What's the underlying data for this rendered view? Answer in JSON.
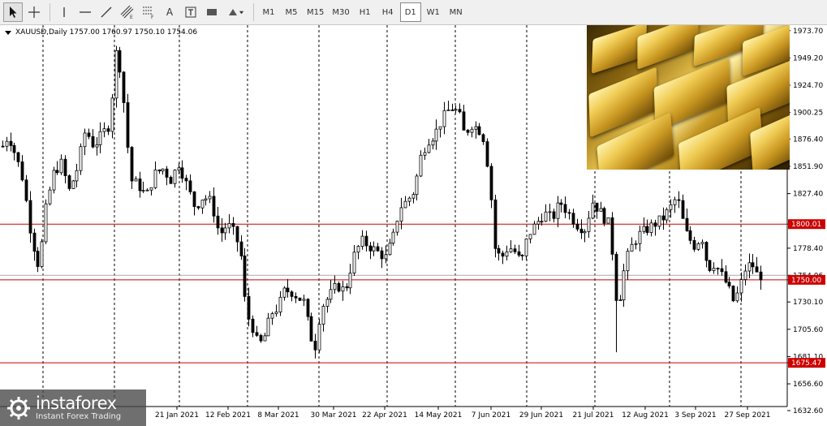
{
  "toolbar": {
    "tools": [
      {
        "name": "cursor-tool",
        "icon": "arrow-cursor-icon"
      },
      {
        "name": "crosshair-tool",
        "icon": "crosshair-icon"
      },
      {
        "name": "vertical-line-tool",
        "icon": "vertical-line-icon"
      },
      {
        "name": "horizontal-line-tool",
        "icon": "horizontal-line-icon"
      },
      {
        "name": "trendline-tool",
        "icon": "trendline-icon"
      },
      {
        "name": "equidistant-channel-tool",
        "icon": "channel-icon"
      },
      {
        "name": "fibonacci-tool",
        "icon": "fibonacci-icon"
      },
      {
        "name": "text-tool",
        "label": "A"
      },
      {
        "name": "text-label-tool",
        "icon": "text-label-icon"
      },
      {
        "name": "rectangle-tool",
        "icon": "rectangle-icon"
      },
      {
        "name": "shapes-dropdown",
        "icon": "shapes-icon"
      }
    ],
    "timeframes": [
      "M1",
      "M5",
      "M15",
      "M30",
      "H1",
      "H4",
      "D1",
      "W1",
      "MN"
    ],
    "active_timeframe": "D1"
  },
  "chart": {
    "symbol_line": "XAUUSD,Daily  1757.00 1760.97 1750.10 1754.06",
    "y_ticks": [
      "1973.70",
      "1949.20",
      "1924.70",
      "1900.25",
      "1876.40",
      "1851.90",
      "1827.40",
      "1800.01",
      "1778.40",
      "1754.06",
      "1750.00",
      "1730.10",
      "1705.60",
      "1681.10",
      "1675.47",
      "1656.60",
      "1632.60"
    ],
    "x_ticks": [
      "21 Jan 2021",
      "12 Feb 2021",
      "8 Mar 2021",
      "30 Mar 2021",
      "22 Apr 2021",
      "14 May 2021",
      "7 Jun 2021",
      "29 Jun 2021",
      "21 Jul 2021",
      "12 Aug 2021",
      "3 Sep 2021",
      "27 Sep 2021"
    ],
    "levels": [
      {
        "price": 1800.01,
        "label": "1800.01",
        "color": "#cc0000"
      },
      {
        "price": 1750.0,
        "label": "1750.00",
        "color": "#cc0000"
      },
      {
        "price": 1675.47,
        "label": "1675.47",
        "color": "#cc0000"
      }
    ],
    "current_price": 1754.06,
    "bull_color": "#000000",
    "bear_color": "#000000"
  },
  "chart_data": {
    "type": "candlestick",
    "ylim": [
      1632.6,
      1975
    ],
    "candles": []
  },
  "watermark": {
    "brand": "instaforex",
    "tagline": "Instant Forex Trading"
  }
}
